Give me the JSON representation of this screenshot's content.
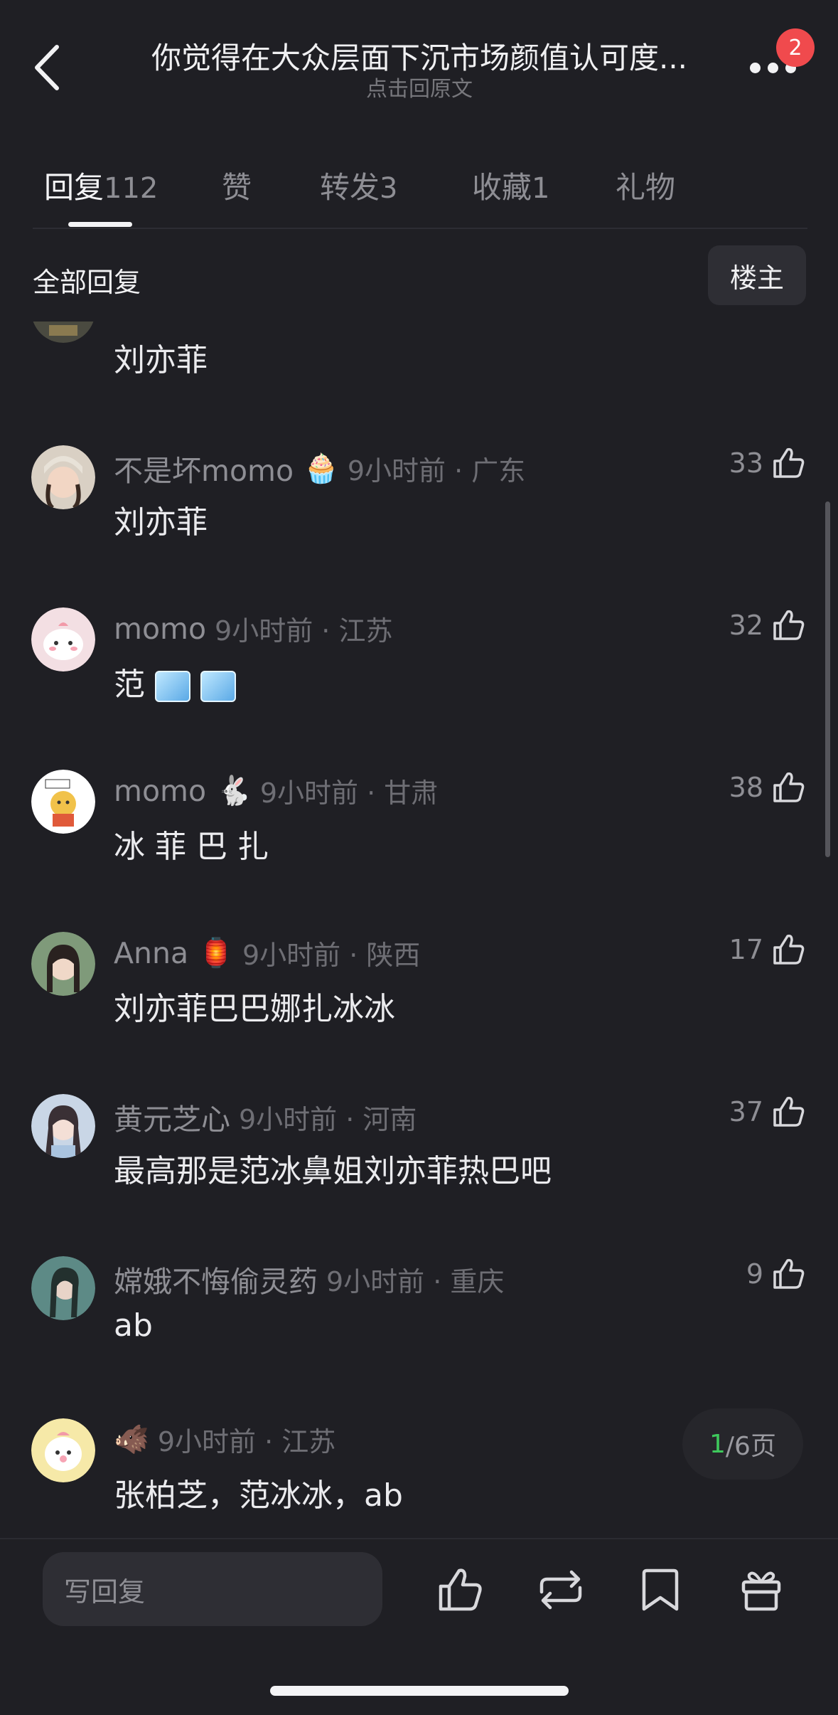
{
  "header": {
    "title": "你觉得在大众层面下沉市场颜值认可度...",
    "subtitle": "点击回原文",
    "notification_count": "2"
  },
  "tabs": [
    {
      "label": "回复",
      "count": "112"
    },
    {
      "label": "赞",
      "count": ""
    },
    {
      "label": "转发",
      "count": "3"
    },
    {
      "label": "收藏",
      "count": "1"
    },
    {
      "label": "礼物",
      "count": ""
    }
  ],
  "section": {
    "label": "全部回复",
    "owner_button": "楼主"
  },
  "comments": [
    {
      "content": "刘亦菲"
    },
    {
      "name": "不是坏momo",
      "emoji": "🧁",
      "time": "9小时前 · 广东",
      "likes": "33",
      "content": "刘亦菲"
    },
    {
      "name": "momo",
      "emoji": "",
      "time": "9小时前 · 江苏",
      "likes": "32",
      "content": "范"
    },
    {
      "name": "momo",
      "emoji": "🐇",
      "time": "9小时前 · 甘肃",
      "likes": "38",
      "content": "冰 菲 巴 扎"
    },
    {
      "name": "Anna",
      "emoji": "🏮",
      "time": "9小时前 · 陕西",
      "likes": "17",
      "content": "刘亦菲巴巴娜扎冰冰"
    },
    {
      "name": "黄元芝心",
      "emoji": "",
      "time": "9小时前 · 河南",
      "likes": "37",
      "content": "最高那是范冰鼻姐刘亦菲热巴吧"
    },
    {
      "name": "嫦娥不悔偷灵药",
      "emoji": "",
      "time": "9小时前 · 重庆",
      "likes": "9",
      "content": "ab"
    },
    {
      "name": "",
      "emoji": "🐗",
      "time": "9小时前 · 江苏",
      "likes": "",
      "content": "张柏芝，范冰冰，ab"
    }
  ],
  "pager": {
    "current": "1",
    "rest": "/6页"
  },
  "bottom": {
    "reply_placeholder": "写回复"
  },
  "colors": {
    "background": "#1f1f24",
    "badge": "#f04a4d",
    "page_current": "#3ec95c"
  }
}
